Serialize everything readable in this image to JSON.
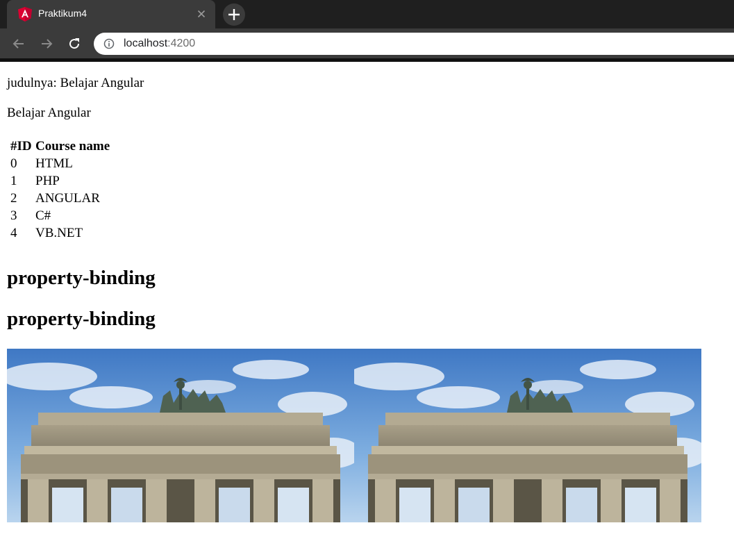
{
  "browser": {
    "tab_title": "Praktikum4",
    "favicon_icon": "angular-logo-icon",
    "close_icon": "close-icon",
    "new_tab_icon": "plus-icon",
    "back_icon": "arrow-left-icon",
    "forward_icon": "arrow-right-icon",
    "reload_icon": "reload-icon",
    "address_icon": "info-icon",
    "url_host": "localhost",
    "url_port": ":4200"
  },
  "page": {
    "line1": "judulnya: Belajar Angular",
    "line2": "Belajar Angular",
    "table": {
      "headers": [
        "#ID",
        "Course name"
      ],
      "rows": [
        {
          "id": "0",
          "name": "HTML"
        },
        {
          "id": "1",
          "name": "PHP"
        },
        {
          "id": "2",
          "name": "ANGULAR"
        },
        {
          "id": "3",
          "name": "C#"
        },
        {
          "id": "4",
          "name": "VB.NET"
        }
      ]
    },
    "heading1": "property-binding",
    "heading2": "property-binding",
    "images": [
      "brandenburg-gate-photo",
      "brandenburg-gate-photo"
    ]
  },
  "colors": {
    "tabstrip": "#1f1f1f",
    "tab_active": "#3b3b3b",
    "angular_red": "#dd0031",
    "sky_blue": "#6d9fd6"
  }
}
